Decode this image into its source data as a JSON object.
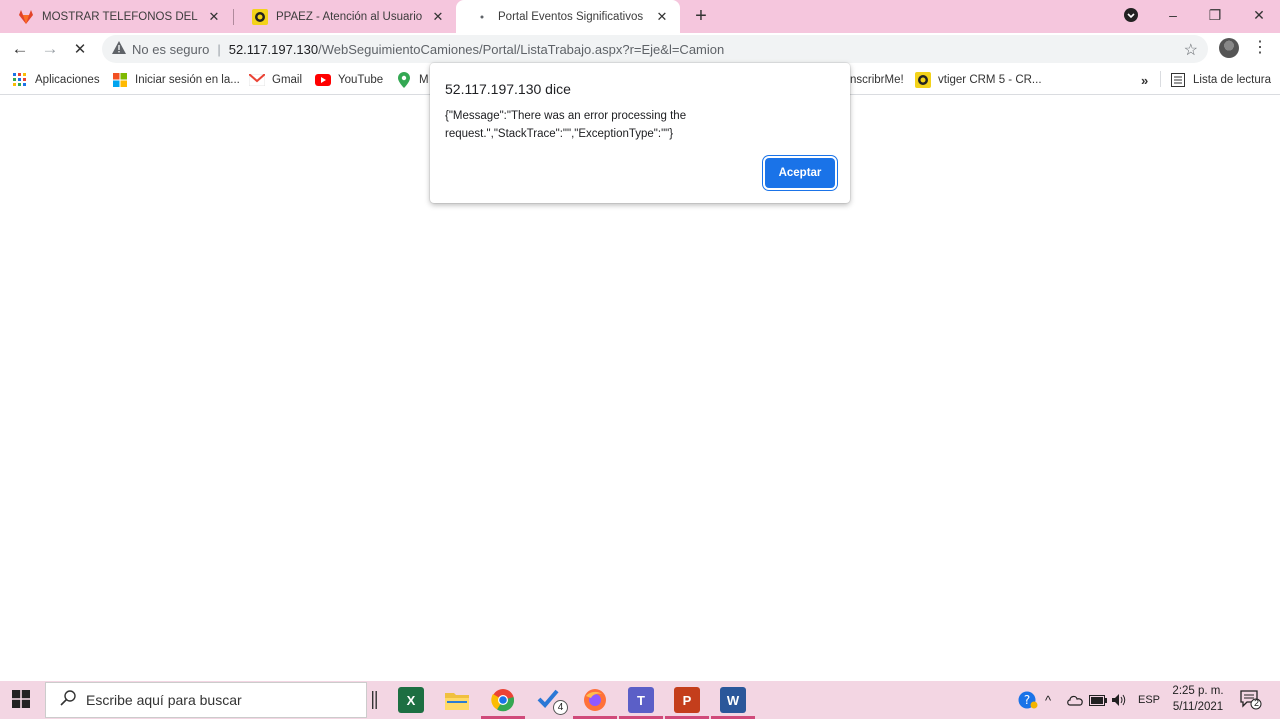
{
  "browser": {
    "tabs": [
      {
        "title": "MOSTRAR TELÉFONOS DEL CON",
        "active": false,
        "favicon": "gitlab-fox-icon"
      },
      {
        "title": "PPAEZ - Atención al Usuario - - v",
        "active": false,
        "favicon": "vtiger-yellow-icon"
      },
      {
        "title": "Portal Eventos Significativos",
        "active": true,
        "favicon": "loading-dot-icon"
      }
    ],
    "new_tab_symbol": "+",
    "window_controls": {
      "minimize": "–",
      "restore": "❐",
      "close": "✕"
    },
    "toolbar": {
      "back_symbol": "←",
      "forward_symbol": "→",
      "stop_symbol": "✕",
      "security_label": "No es seguro",
      "url_host": "52.117.197.130",
      "url_path": "/WebSeguimientoCamiones/Portal/ListaTrabajo.aspx?r=Eje&l=Camion",
      "star_symbol": "☆",
      "menu_symbol": "⋮"
    },
    "bookmarks": [
      {
        "label": "Aplicaciones",
        "icon": "apps-grid-icon"
      },
      {
        "label": "Iniciar sesión en la...",
        "icon": "microsoft-logo-icon"
      },
      {
        "label": "Gmail",
        "icon": "gmail-icon"
      },
      {
        "label": "YouTube",
        "icon": "youtube-icon"
      },
      {
        "label": "M",
        "icon": "maps-pin-icon"
      },
      {
        "label": "nscribrMe!",
        "icon": ""
      },
      {
        "label": "vtiger CRM 5 - CR...",
        "icon": "vtiger-yellow-icon"
      }
    ],
    "overflow_symbol": "»",
    "reading_list_label": "Lista de lectura"
  },
  "dialog": {
    "title": "52.117.197.130 dice",
    "message": "{\"Message\":\"There was an error processing the request.\",\"StackTrace\":\"\",\"ExceptionType\":\"\"}",
    "ok_label": "Aceptar"
  },
  "taskbar": {
    "search_placeholder": "Escribe aquí para buscar",
    "apps": [
      "excel",
      "file-explorer",
      "chrome",
      "visual-studio",
      "firefox",
      "teams",
      "powerpoint",
      "word"
    ],
    "vs_badge": "4",
    "language": "ESP",
    "time": "2:25 p. m.",
    "date": "5/11/2021",
    "notification_count": "2"
  },
  "colors": {
    "tabstrip": "#f5c6dd",
    "taskbar": "#f3d6e3",
    "accent": "#1a73e8"
  }
}
